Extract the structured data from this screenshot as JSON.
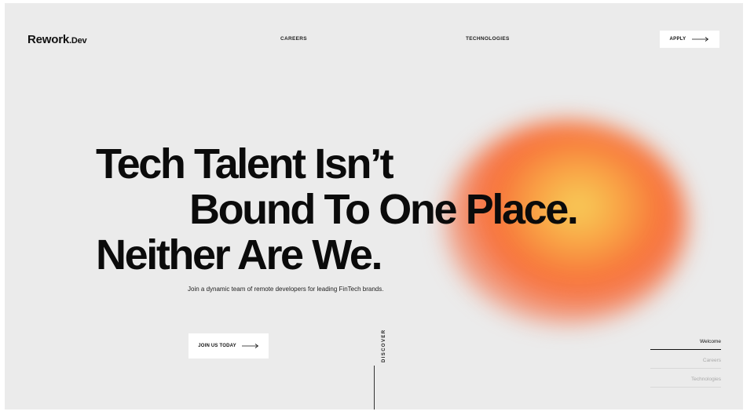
{
  "brand": {
    "name": "Rework",
    "suffix": ".Dev"
  },
  "nav": {
    "careers": "CAREERS",
    "technologies": "TECHNOLOGIES",
    "apply": "APPLY"
  },
  "hero": {
    "line1": "Tech Talent Isn’t",
    "line2": "Bound To One Place.",
    "line3": "Neither Are We.",
    "subtitle": "Join a dynamic team of remote developers for leading FinTech brands.",
    "cta": "JOIN US TODAY"
  },
  "discover": "DISCOVER",
  "side_nav": {
    "items": [
      {
        "label": "Welcome",
        "active": true
      },
      {
        "label": "Careers",
        "active": false
      },
      {
        "label": "Technologies",
        "active": false
      }
    ]
  },
  "colors": {
    "background": "#ebebeb",
    "text": "#0b0b0b",
    "blob_core": "#f7cf5a",
    "blob_outer": "#f76e3a"
  }
}
